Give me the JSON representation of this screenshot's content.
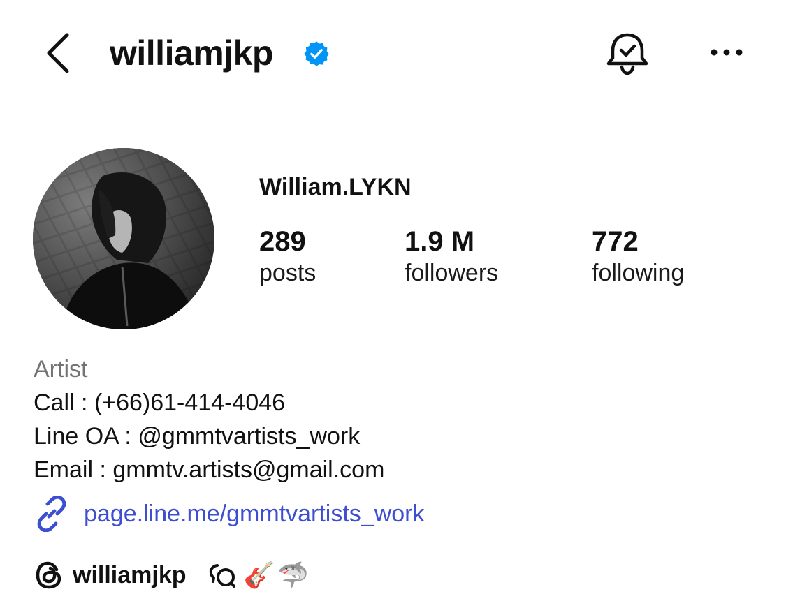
{
  "header": {
    "username": "williamjkp",
    "verified": true,
    "back_icon": "chevron-left-icon",
    "bell_icon": "bell-check-icon",
    "more_icon": "more-horizontal-icon"
  },
  "profile": {
    "display_name": "William.LYKN",
    "avatar_icon": "profile-photo",
    "stats": [
      {
        "value": "289",
        "label": "posts"
      },
      {
        "value": "1.9 M",
        "label": "followers"
      },
      {
        "value": "772",
        "label": "following"
      }
    ]
  },
  "bio": {
    "category": "Artist",
    "lines": [
      "Call : (+66)61-414-4046",
      "Line OA : @gmmtvartists_work",
      "Email : gmmtv.artists@gmail.com"
    ],
    "link": "page.line.me/gmmtvartists_work"
  },
  "threads": {
    "handle": "williamjkp",
    "emojis": [
      "🎸",
      "🦈"
    ]
  },
  "colors": {
    "link": "#3d4fd0",
    "verified": "#0095f6",
    "category": "#737373"
  }
}
